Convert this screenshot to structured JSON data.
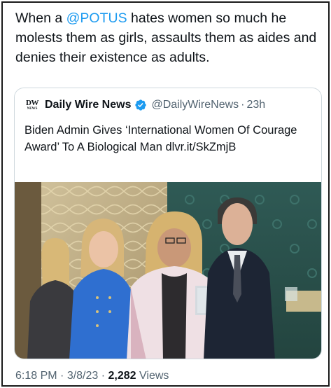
{
  "tweet": {
    "text_before": "When a ",
    "mention": "@POTUS",
    "text_after": " hates women so much he molests them as girls, assaults them as aides and denies their existence as adults."
  },
  "quote": {
    "avatar_text_big": "DW",
    "avatar_text_small": "NEWS",
    "name": "Daily Wire News",
    "handle": "@DailyWireNews",
    "separator": "·",
    "time": "23h",
    "text": "Biden Admin Gives ‘International Women Of Courage Award’ To A Biological Man dlvr.it/SkZmjB"
  },
  "meta": {
    "time": "6:18 PM",
    "sep1": " · ",
    "date": "3/8/23",
    "sep2": " · ",
    "views_count": "2,282",
    "views_label": " Views"
  },
  "colors": {
    "link": "#1d9bf0",
    "secondary": "#536471",
    "verified": "#1d9bf0"
  },
  "icons": {
    "verified": "verified-badge-icon"
  }
}
